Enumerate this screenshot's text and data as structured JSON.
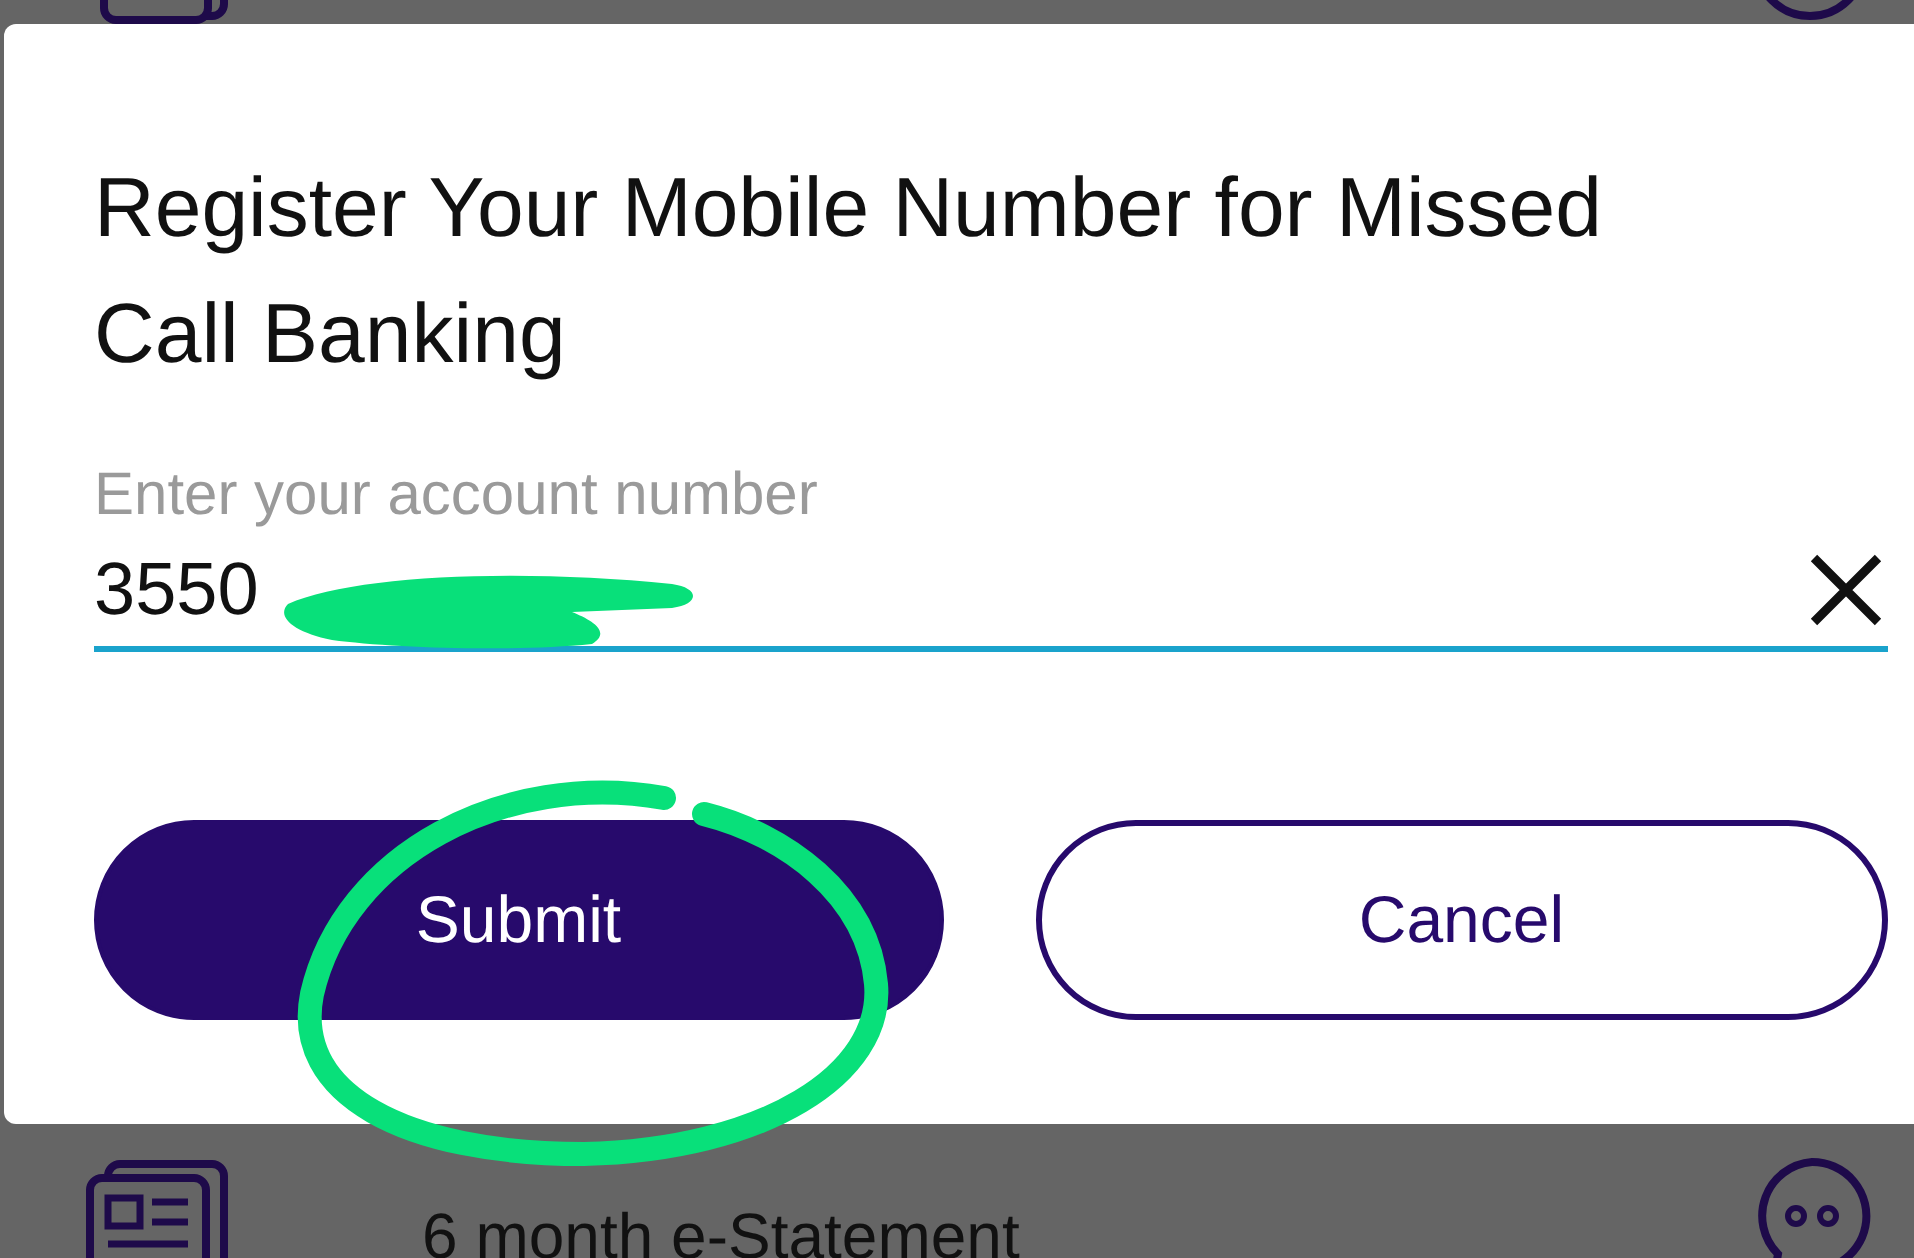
{
  "dialog": {
    "title": "Register Your Mobile Number for Missed Call Banking",
    "field": {
      "label": "Enter your account number",
      "value": "3550"
    },
    "buttons": [
      {
        "label": "Submit",
        "kind": "primary"
      },
      {
        "label": "Cancel",
        "kind": "outline"
      }
    ]
  },
  "background_row": {
    "label": "6 month e-Statement"
  }
}
